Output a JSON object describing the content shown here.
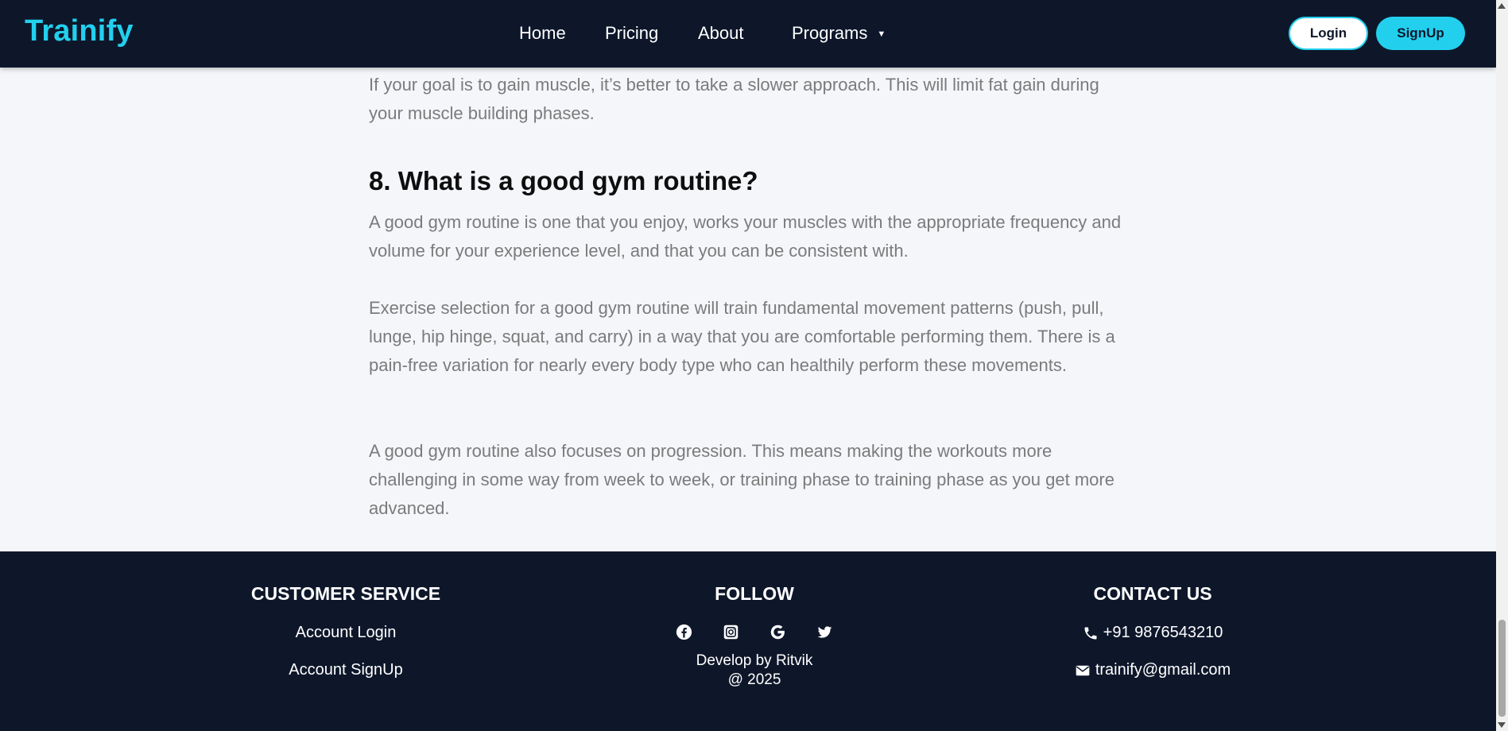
{
  "navbar": {
    "brand": "Trainify",
    "links": [
      "Home",
      "Pricing",
      "About",
      "Programs"
    ],
    "login_label": "Login",
    "signup_label": "SignUp"
  },
  "content": {
    "intro_paragraph": "If your goal is to gain muscle, it’s better to take a slower approach. This will limit fat gain during your muscle building phases.",
    "heading": "8. What is a good gym routine?",
    "paragraphs": [
      "A good gym routine is one that you enjoy, works your muscles with the appropriate frequency and volume for your experience level, and that you can be consistent with.",
      "Exercise selection for a good gym routine will train fundamental movement patterns (push, pull, lunge, hip hinge, squat, and carry) in a way that you are comfortable performing them. There is a pain-free variation for nearly every body type who can healthily perform these movements.",
      "A good gym routine also focuses on progression. This means making the workouts more challenging in some way from week to week, or training phase to training phase as you get more advanced."
    ]
  },
  "footer": {
    "customer_service": {
      "title": "CUSTOMER SERVICE",
      "links": [
        "Account Login",
        "Account SignUp"
      ]
    },
    "follow": {
      "title": "FOLLOW",
      "icons": [
        "facebook-icon",
        "instagram-icon",
        "google-icon",
        "twitter-icon"
      ],
      "credit_line1": "Develop by Ritvik",
      "credit_line2": "@ 2025"
    },
    "contact": {
      "title": "CONTACT US",
      "phone": "+91 9876543210",
      "email": "trainify@gmail.com"
    }
  },
  "colors": {
    "navy": "#0e172a",
    "accent": "#22d0ee",
    "body_bg": "#f4f6fa",
    "paragraph": "#7b7b7b"
  }
}
